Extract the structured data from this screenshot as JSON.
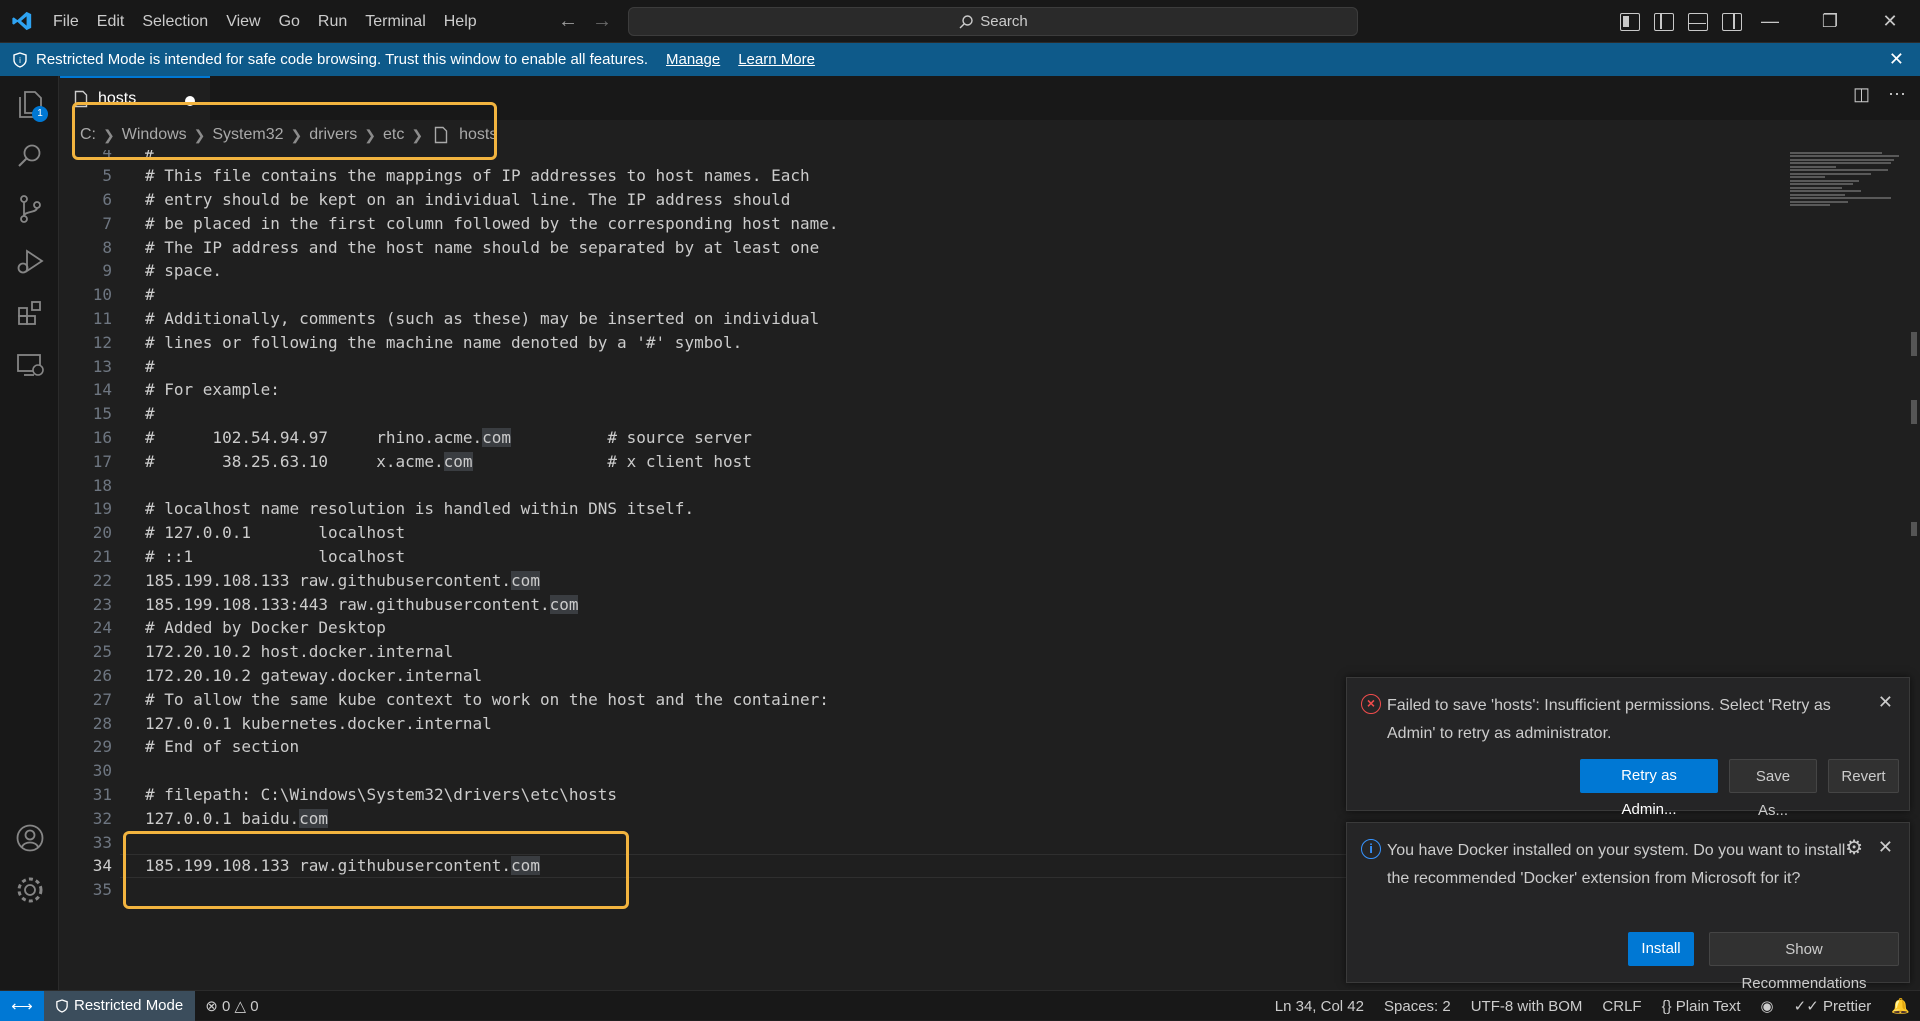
{
  "menu": [
    "File",
    "Edit",
    "Selection",
    "View",
    "Go",
    "Run",
    "Terminal",
    "Help"
  ],
  "search": {
    "label": "Search"
  },
  "banner": {
    "message": "Restricted Mode is intended for safe code browsing. Trust this window to enable all features.",
    "manage": "Manage",
    "learn_more": "Learn More"
  },
  "activity": {
    "badge": "1"
  },
  "tab": {
    "label": "hosts"
  },
  "breadcrumb": [
    "C:",
    "Windows",
    "System32",
    "drivers",
    "etc",
    "hosts"
  ],
  "editor": {
    "current_line": 34,
    "lines": [
      {
        "n": "4",
        "text": "#"
      },
      {
        "n": "5",
        "text": "# This file contains the mappings of IP addresses to host names. Each"
      },
      {
        "n": "6",
        "text": "# entry should be kept on an individual line. The IP address should"
      },
      {
        "n": "7",
        "text": "# be placed in the first column followed by the corresponding host name."
      },
      {
        "n": "8",
        "text": "# The IP address and the host name should be separated by at least one"
      },
      {
        "n": "9",
        "text": "# space."
      },
      {
        "n": "10",
        "text": "#"
      },
      {
        "n": "11",
        "text": "# Additionally, comments (such as these) may be inserted on individual"
      },
      {
        "n": "12",
        "text": "# lines or following the machine name denoted by a '#' symbol."
      },
      {
        "n": "13",
        "text": "#"
      },
      {
        "n": "14",
        "text": "# For example:"
      },
      {
        "n": "15",
        "text": "#"
      },
      {
        "n": "16",
        "text": "#      102.54.94.97     rhino.acme.",
        "hl": "com",
        "after": "          # source server"
      },
      {
        "n": "17",
        "text": "#       38.25.63.10     x.acme.",
        "hl": "com",
        "after": "              # x client host"
      },
      {
        "n": "18",
        "text": ""
      },
      {
        "n": "19",
        "text": "# localhost name resolution is handled within DNS itself."
      },
      {
        "n": "20",
        "text": "# 127.0.0.1       localhost"
      },
      {
        "n": "21",
        "text": "# ::1             localhost"
      },
      {
        "n": "22",
        "text": "185.199.108.133 raw.githubusercontent.",
        "hl": "com"
      },
      {
        "n": "23",
        "text": "185.199.108.133:443 raw.githubusercontent.",
        "hl": "com"
      },
      {
        "n": "24",
        "text": "# Added by Docker Desktop"
      },
      {
        "n": "25",
        "text": "172.20.10.2 host.docker.internal"
      },
      {
        "n": "26",
        "text": "172.20.10.2 gateway.docker.internal"
      },
      {
        "n": "27",
        "text": "# To allow the same kube context to work on the host and the container:"
      },
      {
        "n": "28",
        "text": "127.0.0.1 kubernetes.docker.internal"
      },
      {
        "n": "29",
        "text": "# End of section"
      },
      {
        "n": "30",
        "text": ""
      },
      {
        "n": "31",
        "text": "# filepath: C:\\Windows\\System32\\drivers\\etc\\hosts"
      },
      {
        "n": "32",
        "text": "127.0.0.1 baidu.",
        "hl": "com"
      },
      {
        "n": "33",
        "text": ""
      },
      {
        "n": "34",
        "text": "185.199.108.133 raw.githubusercontent.",
        "hl": "com"
      },
      {
        "n": "35",
        "text": ""
      }
    ]
  },
  "notifications": {
    "error": {
      "message": "Failed to save 'hosts': Insufficient permissions. Select 'Retry as Admin' to retry as administrator.",
      "retry": "Retry as Admin...",
      "save_as": "Save As...",
      "revert": "Revert"
    },
    "info": {
      "message": "You have Docker installed on your system. Do you want to install the recommended 'Docker' extension from Microsoft for it?",
      "install": "Install",
      "show_recs": "Show Recommendations"
    }
  },
  "status": {
    "restricted": "Restricted Mode",
    "errors": "0",
    "warnings": "0",
    "position": "Ln 34, Col 42",
    "spaces": "Spaces: 2",
    "encoding": "UTF-8 with BOM",
    "eol": "CRLF",
    "language": "Plain Text",
    "prettier": "Prettier"
  },
  "colors": {
    "accent": "#0078d4",
    "banner": "#0e5a8a",
    "highlight_box": "#f2b43f",
    "error": "#f14c4c",
    "info": "#3794ff"
  }
}
